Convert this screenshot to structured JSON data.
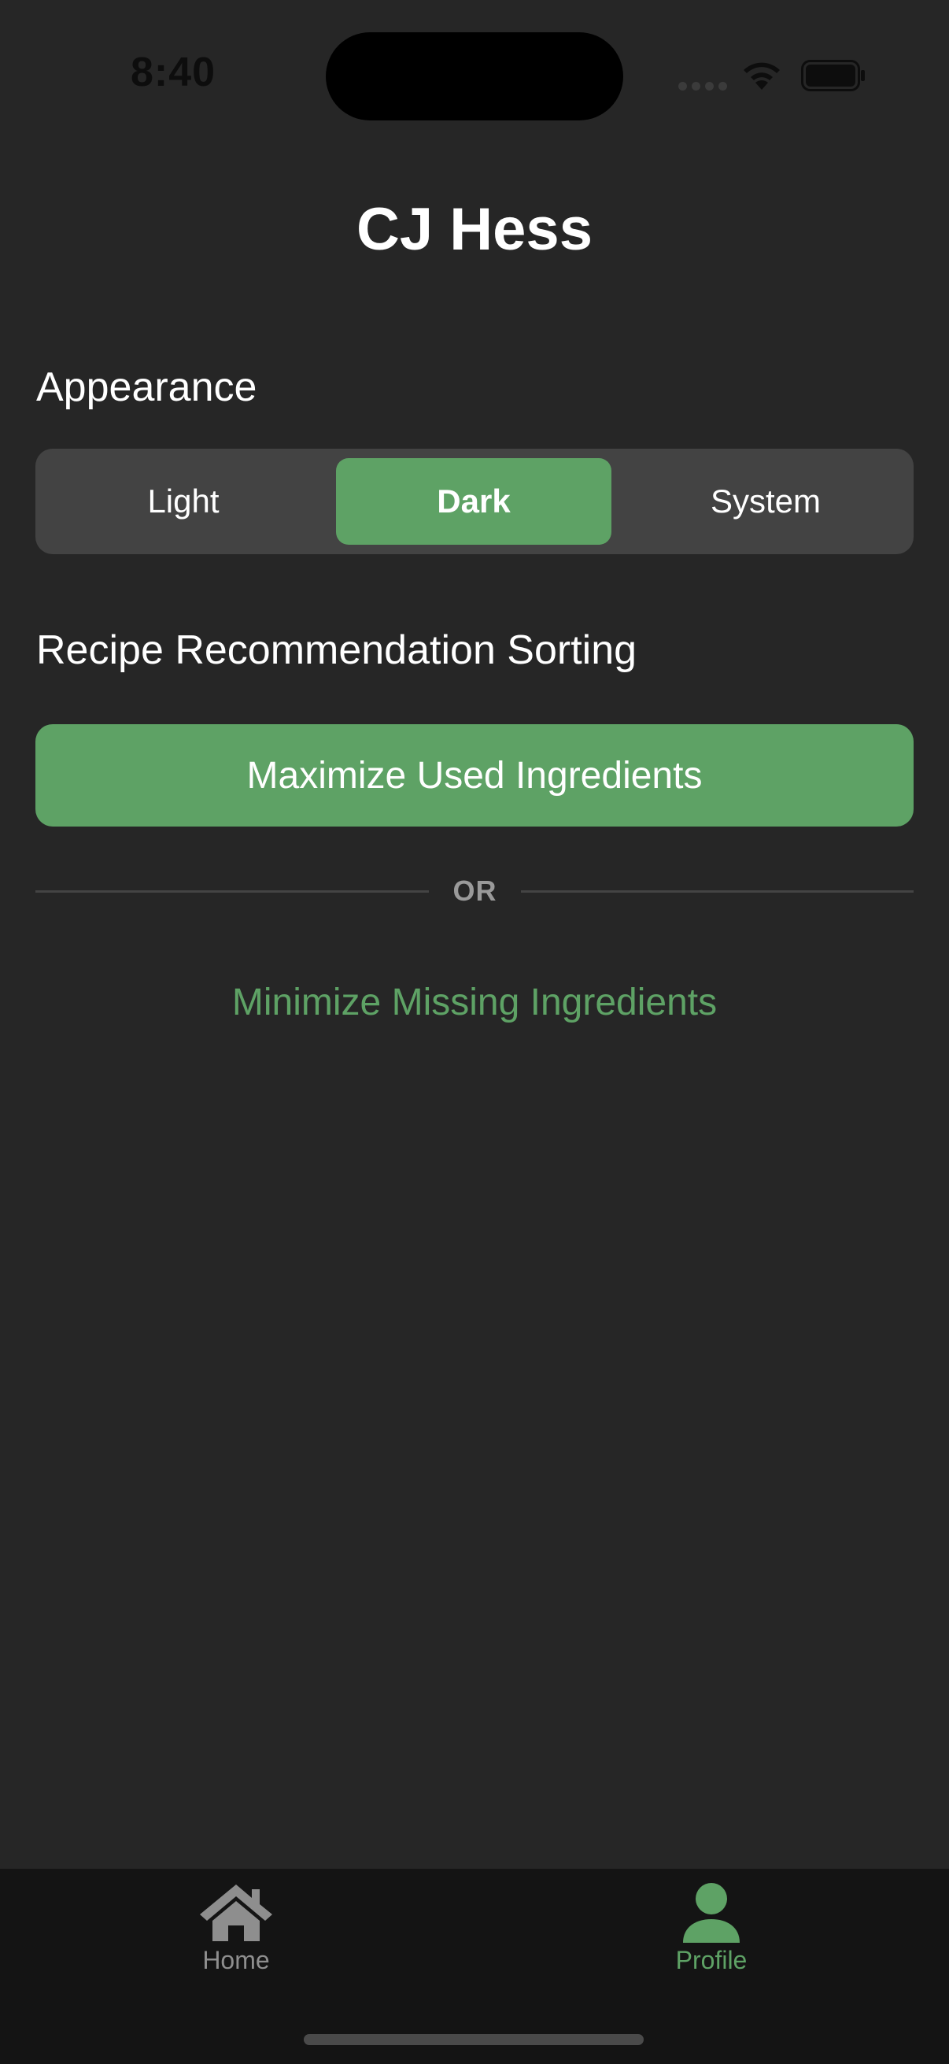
{
  "status_bar": {
    "time": "8:40"
  },
  "profile": {
    "name": "CJ Hess"
  },
  "appearance": {
    "heading": "Appearance",
    "options": [
      "Light",
      "Dark",
      "System"
    ],
    "selected": "Dark"
  },
  "sorting": {
    "heading": "Recipe Recommendation Sorting",
    "selected_option": "Maximize Used Ingredients",
    "separator": "OR",
    "alternate_option": "Minimize Missing Ingredients"
  },
  "tab_bar": {
    "items": [
      {
        "label": "Home",
        "icon": "house-icon",
        "active": false
      },
      {
        "label": "Profile",
        "icon": "person-icon",
        "active": true
      }
    ]
  },
  "colors": {
    "accent": "#5ea265",
    "background": "#262626",
    "tab_bar": "#141414",
    "segmented_background": "#434343"
  }
}
